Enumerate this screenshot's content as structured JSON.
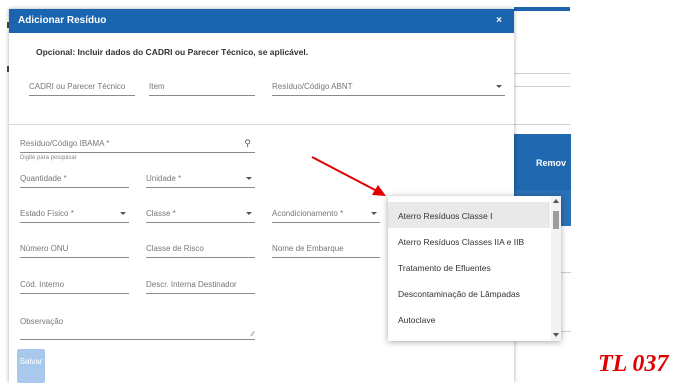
{
  "modal": {
    "title": "Adicionar Resíduo",
    "close": "×",
    "subtitle": "Opcional: Incluir dados do CADRI ou Parecer Técnico, se aplicável.",
    "save_label": "Salvar"
  },
  "fields": {
    "cadri": "CADRI ou Parecer Técnico",
    "item": "Item",
    "abnt": "Resíduo/Código ABNT",
    "ibama": "Resíduo/Código IBAMA *",
    "ibama_hint": "Digite para pesquisar",
    "quantidade": "Quantidade *",
    "unidade": "Unidade *",
    "estado_fisico": "Estado Físico *",
    "classe": "Classe *",
    "acondicionamento": "Acondicionamento *",
    "onu": "Número ONU",
    "classe_risco": "Classe de Risco",
    "embarque": "Nome de Embarque",
    "cod_interno": "Cód. Interno",
    "descr_interna": "Descr. Interna Destinador",
    "observacao": "Observação"
  },
  "dropdown": {
    "items": [
      "Aterro Resíduos Classe I",
      "Aterro Resíduos Classes IIA e IIB",
      "Tratamento de Efluentes",
      "Descontaminação de Lâmpadas",
      "Autoclave"
    ],
    "selected_index": 0
  },
  "background": {
    "header_label": "Remov"
  },
  "annotation": {
    "label": "TL 037"
  },
  "colors": {
    "brand_blue": "#1b64af",
    "save_disabled": "#a9c9ec",
    "annotation_red": "#e00000"
  }
}
